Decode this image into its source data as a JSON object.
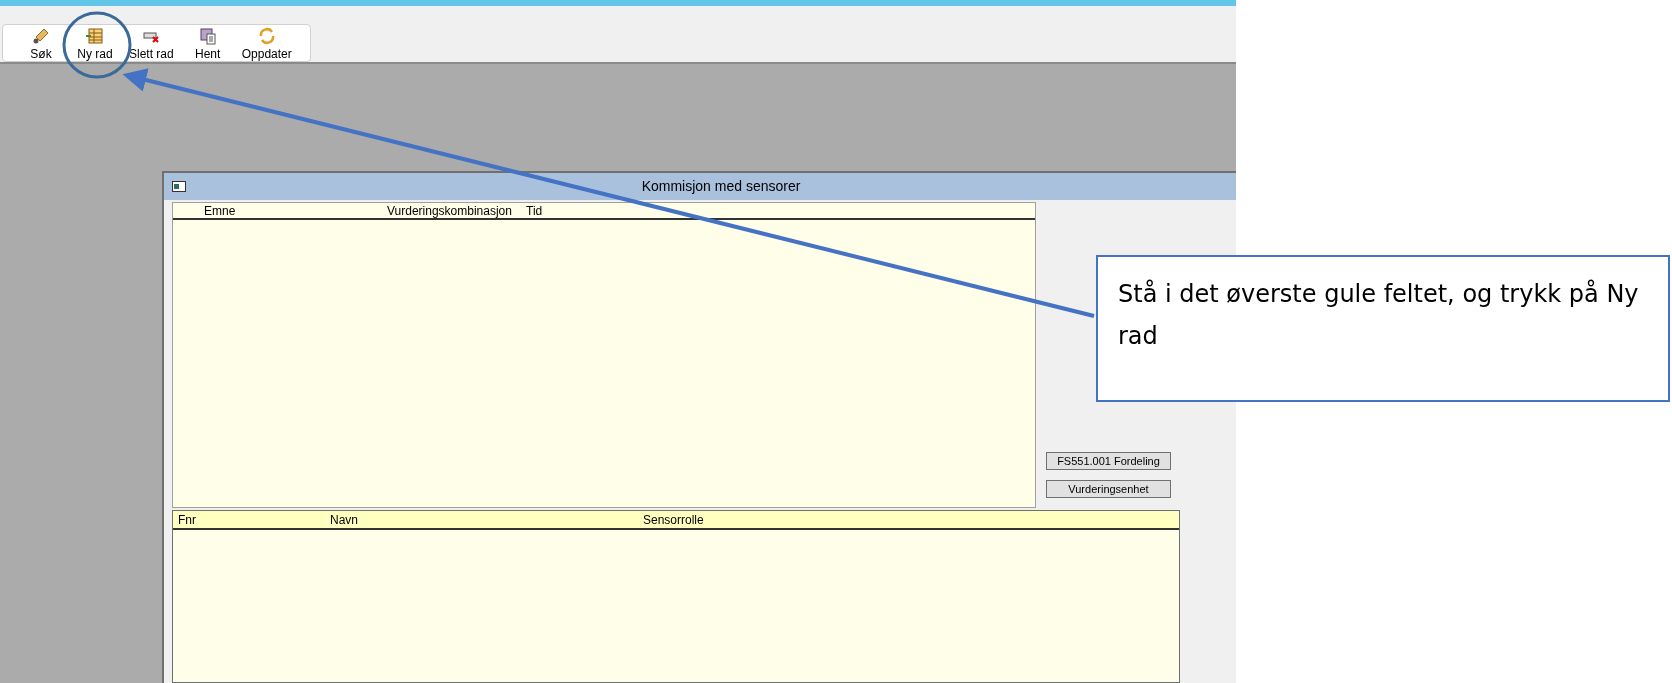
{
  "toolbar": {
    "buttons": [
      {
        "label": "Søk",
        "kind": "search"
      },
      {
        "label": "Ny rad",
        "kind": "new-row"
      },
      {
        "label": "Slett rad",
        "kind": "delete-row"
      },
      {
        "label": "Hent",
        "kind": "fetch"
      },
      {
        "label": "Oppdater",
        "kind": "refresh"
      }
    ]
  },
  "window": {
    "title": "Kommisjon med sensorer"
  },
  "upper_table": {
    "columns": [
      "Emne",
      "Vurderingskombinasjon",
      "Tid"
    ]
  },
  "side_buttons": [
    "FS551.001 Fordeling",
    "Vurderingsenhet"
  ],
  "lower_table": {
    "columns": [
      "Fnr",
      "Navn",
      "Sensorrolle"
    ]
  },
  "annotation": {
    "callout": "Stå i det øverste gule feltet, og trykk på Ny rad"
  }
}
